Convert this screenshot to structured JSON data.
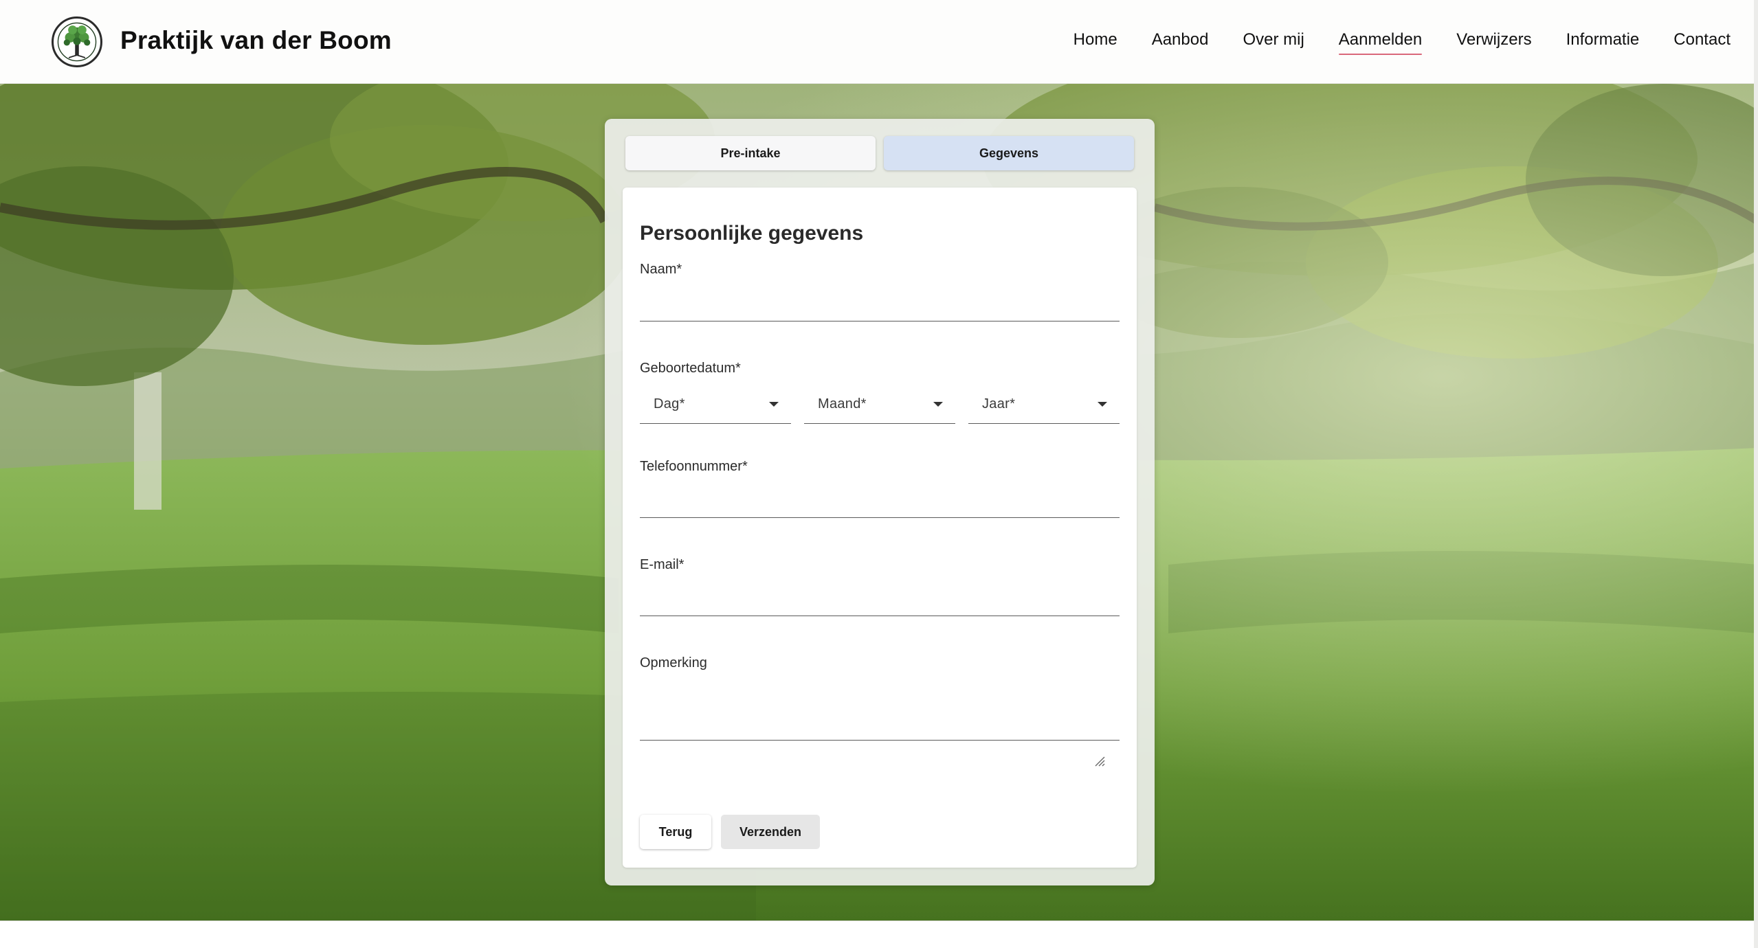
{
  "header": {
    "brand": "Praktijk van der Boom",
    "logo_icon": "tree-logo-icon",
    "nav": [
      {
        "label": "Home",
        "active": false
      },
      {
        "label": "Aanbod",
        "active": false
      },
      {
        "label": "Over mij",
        "active": false
      },
      {
        "label": "Aanmelden",
        "active": true
      },
      {
        "label": "Verwijzers",
        "active": false
      },
      {
        "label": "Informatie",
        "active": false
      },
      {
        "label": "Contact",
        "active": false
      }
    ],
    "active_underline_color": "#d9687a"
  },
  "steps": [
    {
      "label": "Pre-intake",
      "active": false
    },
    {
      "label": "Gegevens",
      "active": true
    }
  ],
  "form": {
    "title": "Persoonlijke gegevens",
    "naam": {
      "label": "Naam*",
      "value": ""
    },
    "geboortedatum": {
      "label": "Geboortedatum*",
      "dag": {
        "label": "Dag*"
      },
      "maand": {
        "label": "Maand*"
      },
      "jaar": {
        "label": "Jaar*"
      }
    },
    "telefoon": {
      "label": "Telefoonnummer*",
      "value": ""
    },
    "email": {
      "label": "E-mail*",
      "value": ""
    },
    "opmerking": {
      "label": "Opmerking",
      "value": ""
    },
    "buttons": {
      "back": "Terug",
      "submit": "Verzenden"
    }
  },
  "colors": {
    "step_active_bg": "#d6e1f3",
    "step_inactive_bg": "#f7f7f8"
  }
}
